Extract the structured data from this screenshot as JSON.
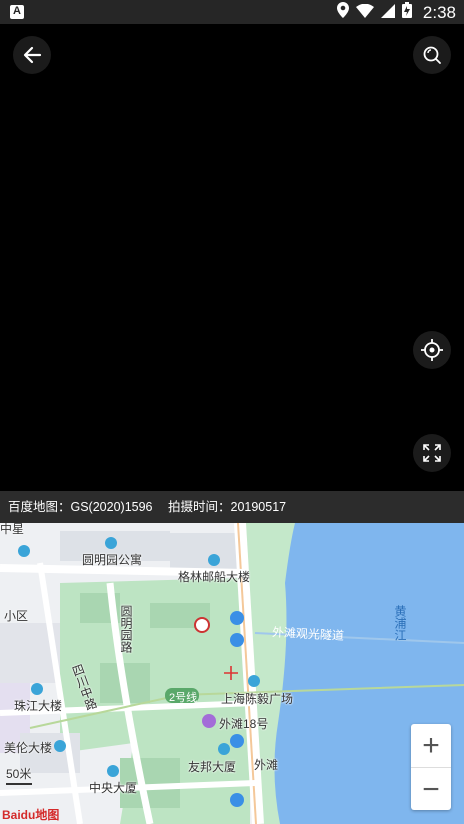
{
  "status_bar": {
    "time": "2:38"
  },
  "panorama": {
    "background": "#000000"
  },
  "info_bar": {
    "map_credit": "百度地图：GS(2020)1596",
    "capture_time": "拍摄时间：20190517"
  },
  "map": {
    "labels": {
      "l1": "圆明园公寓",
      "l2": "格林邮船大楼",
      "l3": "圆明园路",
      "l4": "四川中路",
      "l5": "外滩观光隧道",
      "l6": "黄浦江",
      "l7": "2号线",
      "l8": "上海陈毅广场",
      "l9": "外滩18号",
      "l10": "珠江大楼",
      "l11": "美伦大楼",
      "l12": "友邦大厦",
      "l13": "外滩",
      "l14": "中央大厦",
      "l15": "小区",
      "l16": "中星"
    },
    "scale": "50米",
    "logo": "Baidu地图",
    "colors": {
      "water": "#7fb6ee",
      "green": "#b9e3c0",
      "road": "#ffffff"
    }
  },
  "zoom": {
    "in": "+",
    "out": "−"
  }
}
